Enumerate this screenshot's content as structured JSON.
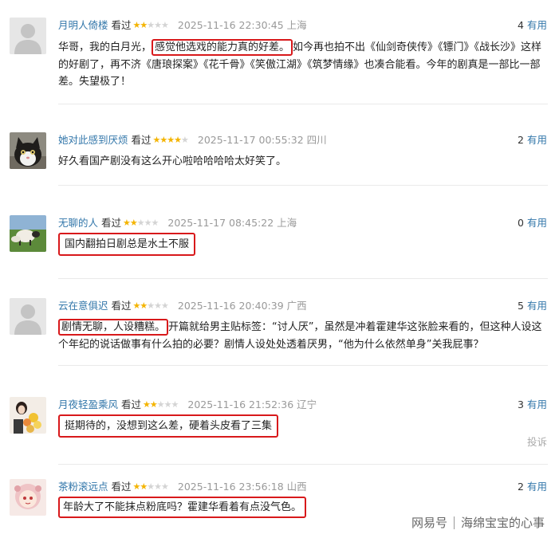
{
  "reviews": [
    {
      "user": "月明人倚楼",
      "watched": "看过",
      "rating": 2,
      "time": "2025-11-16 22:30:45",
      "location": "上海",
      "useful_count": "4",
      "useful_label": "有用",
      "content_pre": "华哥，我的白月光，",
      "content_hl": "感觉他选戏的能力真的好差。",
      "content_post": "如今再也拍不出《仙剑奇侠传》《镖门》《战长沙》这样的好剧了，再不济《唐琅探案》《花千骨》《笑傲江湖》《筑梦情缘》也凑合能看。今年的剧真是一部比一部差。失望极了！",
      "avatar": "default-avatar"
    },
    {
      "user": "她对此感到厌烦",
      "watched": "看过",
      "rating": 4,
      "time": "2025-11-17 00:55:32",
      "location": "四川",
      "useful_count": "2",
      "useful_label": "有用",
      "content_pre": "",
      "content_hl": "",
      "content_post": "好久看国产剧没有这么开心啦哈哈哈哈太好笑了。",
      "avatar": "cat-avatar"
    },
    {
      "user": "无聊的人",
      "watched": "看过",
      "rating": 2,
      "time": "2025-11-17 08:45:22",
      "location": "上海",
      "useful_count": "0",
      "useful_label": "有用",
      "content_pre": "",
      "content_hl": "国内翻拍日剧总是水土不服",
      "content_post": "",
      "avatar": "sheep-avatar"
    },
    {
      "user": "云在意俱迟",
      "watched": "看过",
      "rating": 2,
      "time": "2025-11-16 20:40:39",
      "location": "广西",
      "useful_count": "5",
      "useful_label": "有用",
      "content_pre": "",
      "content_hl": "剧情无聊，人设糟糕。",
      "content_post": "开篇就给男主贴标签：“讨人厌”，虽然是冲着霍建华这张脸来看的，但这种人设这个年纪的说话做事有什么拍的必要？剧情人设处处透着厌男，“他为什么依然单身”关我屁事？",
      "avatar": "default-avatar"
    },
    {
      "user": "月夜轻盈乘风",
      "watched": "看过",
      "rating": 2,
      "time": "2025-11-16 21:52:36",
      "location": "辽宁",
      "useful_count": "3",
      "useful_label": "有用",
      "content_pre": "",
      "content_hl": "挺期待的，没想到这么差，硬着头皮看了三集",
      "content_post": "",
      "avatar": "flowers-avatar"
    },
    {
      "user": "茶粉滚远点",
      "watched": "看过",
      "rating": 2,
      "time": "2025-11-16 23:56:18",
      "location": "山西",
      "useful_count": "2",
      "useful_label": "有用",
      "content_pre": "",
      "content_hl": "年龄大了不能抹点粉底吗？霍建华看着有点没气色。",
      "content_post": "",
      "avatar": "doll-avatar"
    }
  ],
  "report_label": "投诉",
  "watermark": {
    "brand": "网易号",
    "author": "海绵宝宝的心事"
  },
  "colors": {
    "username": "#3377aa",
    "star": "#f4b400",
    "highlight_box": "#d8191b"
  }
}
